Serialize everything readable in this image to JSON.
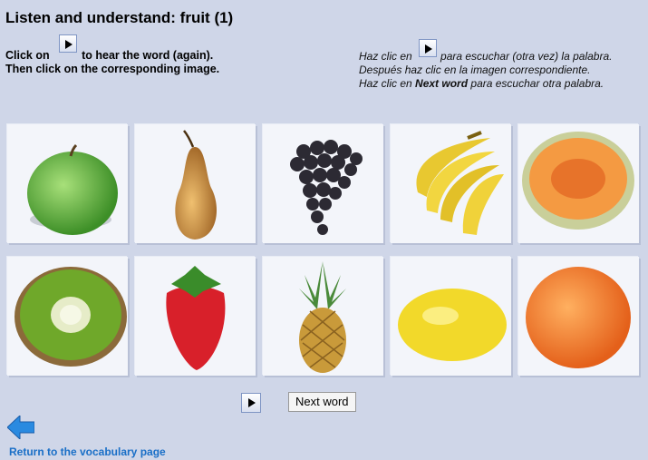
{
  "page": {
    "title": "Listen and understand: fruit (1)"
  },
  "instructions_en": {
    "click_on": "Click on",
    "hear": "to hear the word (again).",
    "then": "Then click on the corresponding image."
  },
  "instructions_es": {
    "haz_clic_en": "Haz clic en",
    "escuchar": "para escuchar (otra vez) la palabra.",
    "despues": "Después haz clic en la imagen correspondiente.",
    "haz_clic_en_2": "Haz clic en",
    "next_word_bold": "Next word",
    "otra": "para escuchar otra palabra."
  },
  "fruits": [
    {
      "name": "apple-image"
    },
    {
      "name": "pear-image"
    },
    {
      "name": "grapes-image"
    },
    {
      "name": "bananas-image"
    },
    {
      "name": "melon-image"
    },
    {
      "name": "kiwi-image"
    },
    {
      "name": "strawberry-image"
    },
    {
      "name": "pineapple-image"
    },
    {
      "name": "lemon-image"
    },
    {
      "name": "orange-image"
    }
  ],
  "controls": {
    "next_word_label": "Next word",
    "return_label": "Return to the vocabulary page"
  },
  "colors": {
    "background": "#cfd6e8",
    "link": "#1a6fc7"
  }
}
